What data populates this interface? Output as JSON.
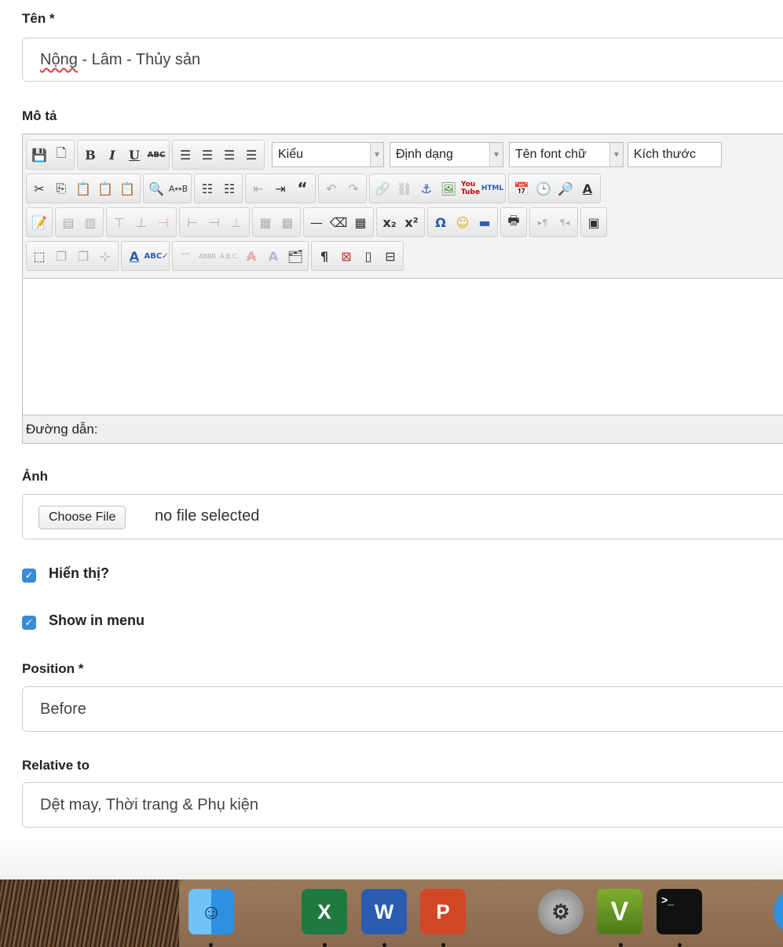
{
  "form": {
    "name": {
      "label": "Tên *",
      "value_spell": "Nộng",
      "value_rest": " - Lâm - Thủy sản"
    },
    "description": {
      "label": "Mô tả"
    },
    "editor": {
      "style_combo": "Kiểu",
      "format_combo": "Định dạng",
      "font_combo": "Tên font chữ",
      "size_combo": "Kích thước",
      "path_label": "Đường dẫn:"
    },
    "image": {
      "label": "Ảnh",
      "button": "Choose File",
      "status": "no file selected"
    },
    "show": {
      "label": "Hiển thị?",
      "checked": true
    },
    "menu": {
      "label": "Show in menu",
      "checked": true
    },
    "position": {
      "label": "Position *",
      "value": "Before"
    },
    "relative": {
      "label": "Relative to",
      "value": "Dệt may, Thời trang & Phụ kiện"
    }
  },
  "dock": {
    "apps": [
      {
        "name": "Finder",
        "glyph": "☺"
      },
      {
        "name": "Excel",
        "glyph": "X"
      },
      {
        "name": "Word",
        "glyph": "W"
      },
      {
        "name": "PowerPoint",
        "glyph": "P"
      },
      {
        "name": "System Preferences",
        "glyph": "⚙"
      },
      {
        "name": "Vim",
        "glyph": "V"
      },
      {
        "name": "Terminal",
        "glyph": ">_"
      }
    ]
  },
  "colors": {
    "checkbox": "#3a8bd8",
    "excel": "#1f7a3f",
    "word": "#2a5db0",
    "powerpoint": "#d24726"
  }
}
